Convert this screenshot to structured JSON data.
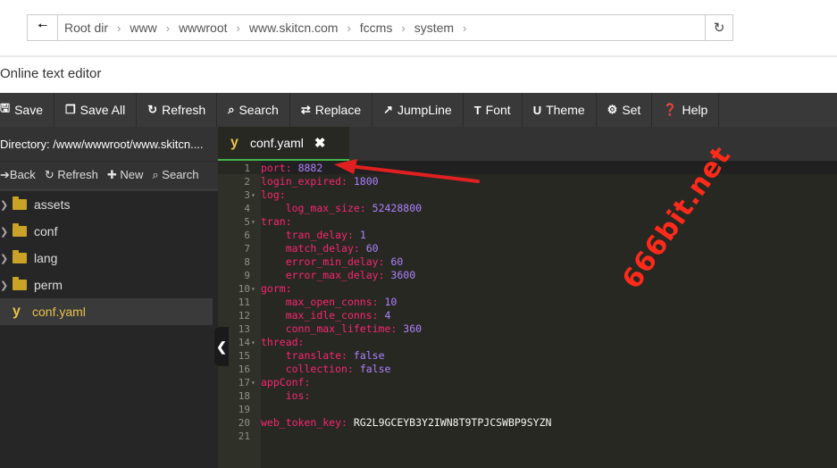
{
  "path_bar": {
    "crumbs": [
      "Root dir",
      "www",
      "wwwroot",
      "www.skitcn.com",
      "fccms",
      "system"
    ]
  },
  "title": "Online text editor",
  "toolbar": {
    "save": "Save",
    "save_all": "Save All",
    "refresh": "Refresh",
    "search": "Search",
    "replace": "Replace",
    "jumpline": "JumpLine",
    "font": "Font",
    "theme": "Theme",
    "set": "Set",
    "help": "Help"
  },
  "sidebar": {
    "directory": "Directory: /www/wwwroot/www.skitcn....",
    "back": "Back",
    "refresh": "Refresh",
    "new": "New",
    "search": "Search",
    "items": [
      "assets",
      "conf",
      "lang",
      "perm",
      "conf.yaml"
    ]
  },
  "tab": {
    "name": "conf.yaml"
  },
  "code": {
    "l1": {
      "key": "port:",
      "val": "8882"
    },
    "l2": {
      "key": "login_expired:",
      "val": "1800"
    },
    "l3": {
      "key": "log:"
    },
    "l4": {
      "key": "log_max_size:",
      "val": "52428800"
    },
    "l5": {
      "key": "tran:"
    },
    "l6": {
      "key": "tran_delay:",
      "val": "1"
    },
    "l7": {
      "key": "match_delay:",
      "val": "60"
    },
    "l8": {
      "key": "error_min_delay:",
      "val": "60"
    },
    "l9": {
      "key": "error_max_delay:",
      "val": "3600"
    },
    "l10": {
      "key": "gorm:"
    },
    "l11": {
      "key": "max_open_conns:",
      "val": "10"
    },
    "l12": {
      "key": "max_idle_conns:",
      "val": "4"
    },
    "l13": {
      "key": "conn_max_lifetime:",
      "val": "360"
    },
    "l14": {
      "key": "thread:"
    },
    "l15": {
      "key": "translate:",
      "val": "false"
    },
    "l16": {
      "key": "collection:",
      "val": "false"
    },
    "l17": {
      "key": "appConf:"
    },
    "l18": {
      "key": "ios:"
    },
    "l20": {
      "key": "web_token_key:",
      "val": "RG2L9GCEYB3Y2IWN8T9TPJCSWBP9SYZN"
    }
  },
  "watermark": "666bit.net",
  "colors": {
    "accent": "#3fb54a",
    "key": "#f92672",
    "number": "#ae81ff",
    "arrow": "#e02020"
  }
}
